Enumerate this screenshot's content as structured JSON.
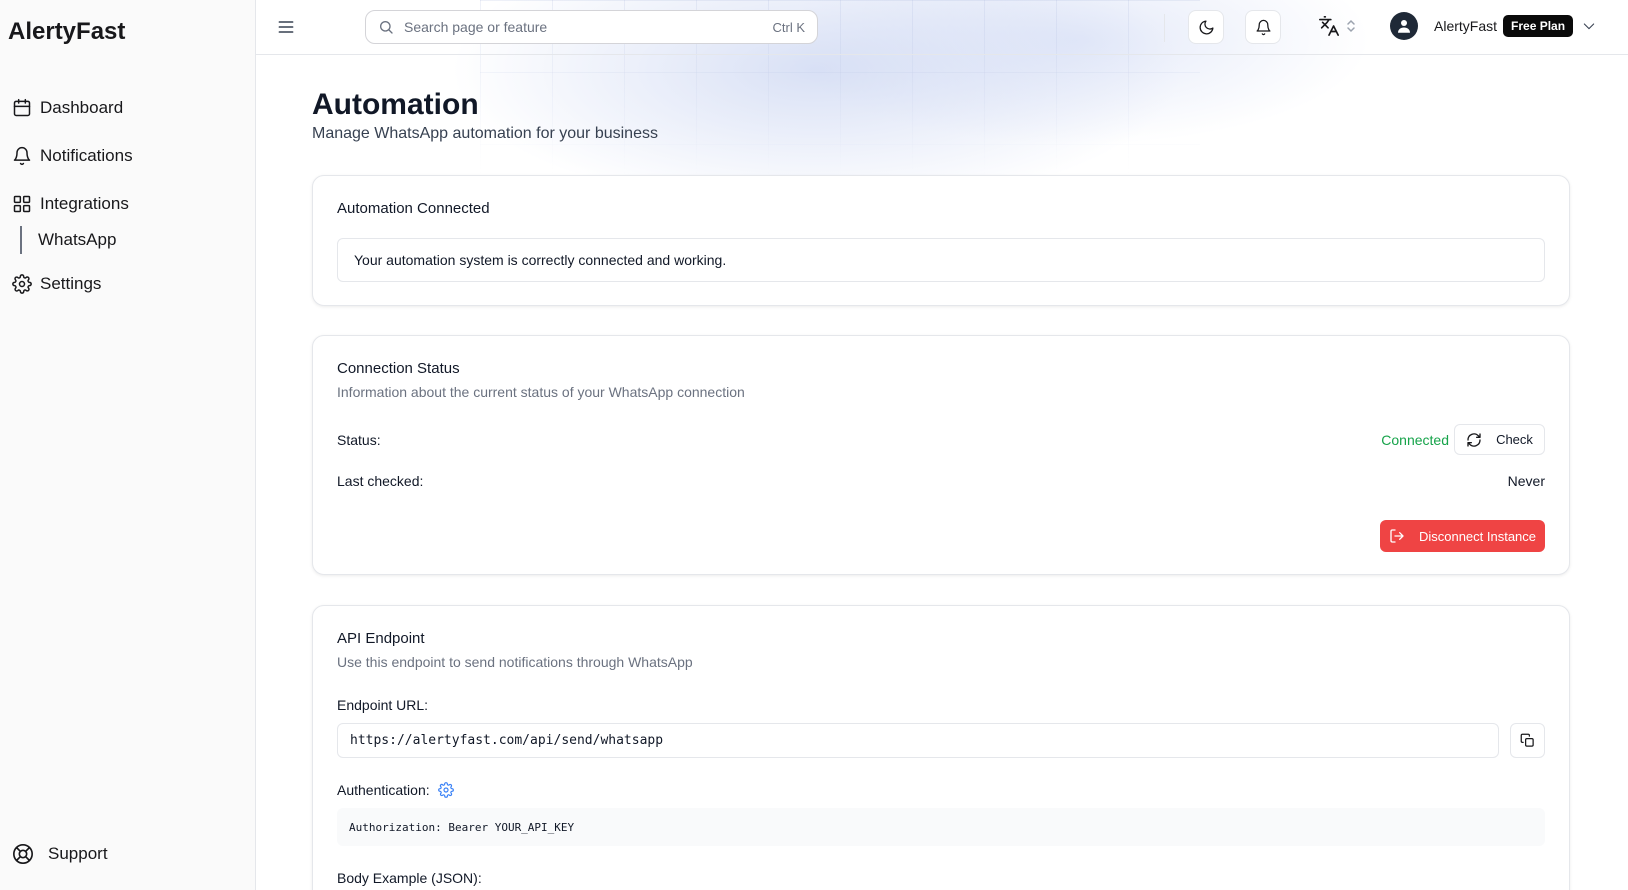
{
  "brand": "AlertyFast",
  "sidebar": {
    "items": [
      {
        "label": "Dashboard",
        "icon": "calendar-icon"
      },
      {
        "label": "Notifications",
        "icon": "bell-icon"
      },
      {
        "label": "Integrations",
        "icon": "grid-icon"
      },
      {
        "label": "Settings",
        "icon": "gear-icon"
      }
    ],
    "sub_item": "WhatsApp",
    "support_label": "Support"
  },
  "header": {
    "search_placeholder": "Search page or feature",
    "search_shortcut": "Ctrl K",
    "user_name": "AlertyFast",
    "plan": "Free Plan"
  },
  "page": {
    "title": "Automation",
    "subtitle": "Manage WhatsApp automation for your business"
  },
  "card_connected": {
    "title": "Automation Connected",
    "message": "Your automation system is correctly connected and working."
  },
  "card_status": {
    "title": "Connection Status",
    "description": "Information about the current status of your WhatsApp connection",
    "status_label": "Status:",
    "status_value": "Connected",
    "check_label": "Check",
    "last_checked_label": "Last checked:",
    "last_checked_value": "Never",
    "disconnect_label": "Disconnect Instance"
  },
  "card_api": {
    "title": "API Endpoint",
    "description": "Use this endpoint to send notifications through WhatsApp",
    "endpoint_label": "Endpoint URL:",
    "endpoint_value": "https://alertyfast.com/api/send/whatsapp",
    "auth_label": "Authentication:",
    "auth_code": "Authorization: Bearer YOUR_API_KEY",
    "body_label": "Body Example (JSON):"
  },
  "colors": {
    "success": "#16a34a",
    "danger": "#ef4444",
    "accent": "#3b82f6"
  }
}
